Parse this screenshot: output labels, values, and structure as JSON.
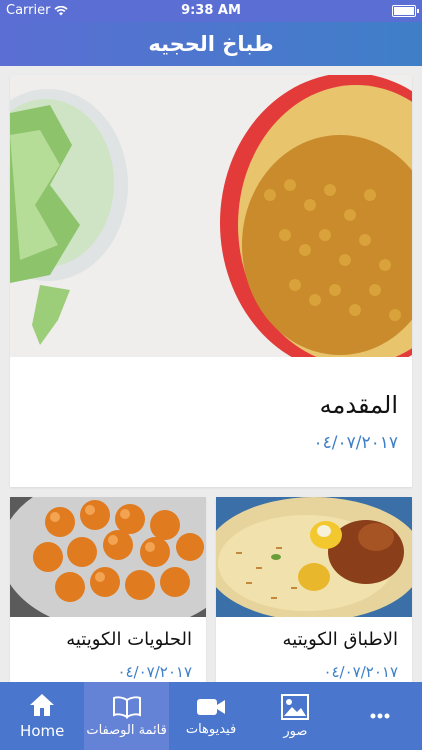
{
  "status": {
    "carrier": "Carrier",
    "time": "9:38 AM"
  },
  "header": {
    "title": "طباخ الحجيه"
  },
  "featured": {
    "title": "المقدمه",
    "date": "٠٤/٠٧/٢٠١٧"
  },
  "cards": [
    {
      "title": "الحلويات الكويتيه",
      "date": "٠٤/٠٧/٢٠١٧"
    },
    {
      "title": "الاطباق الكويتيه",
      "date": "٠٤/٠٧/٢٠١٧"
    }
  ],
  "tabs": [
    {
      "label": "Home",
      "icon": "home-icon"
    },
    {
      "label": "قائمة الوصفات",
      "icon": "book-icon"
    },
    {
      "label": "فيديوهات",
      "icon": "video-camera-icon"
    },
    {
      "label": "صور",
      "icon": "picture-icon"
    },
    {
      "label": "",
      "icon": "more-dots-icon"
    }
  ],
  "colors": {
    "accent": "#3f7fc8",
    "tabbar": "#4a76cd",
    "status": "#5b6ed3"
  }
}
